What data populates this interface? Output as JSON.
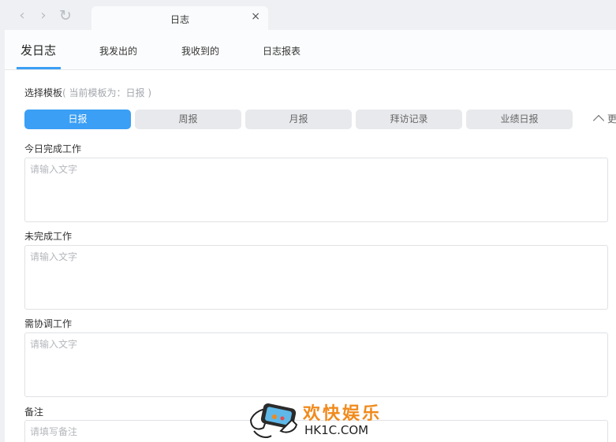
{
  "browser": {
    "back_icon": "‹",
    "forward_icon": "›",
    "reload_icon": "↻",
    "tab_title": "日志",
    "close_icon": "×"
  },
  "subnav": {
    "items": [
      "发日志",
      "我发出的",
      "我收到的",
      "日志报表"
    ],
    "active_index": 0,
    "accent": "#3a9ff5"
  },
  "template": {
    "label": "选择模板",
    "note": "( 当前模板为：日报 )",
    "buttons": [
      "日报",
      "周报",
      "月报",
      "拜访记录",
      "业绩日报"
    ],
    "active_index": 0,
    "more_label": "更"
  },
  "fields": [
    {
      "label": "今日完成工作",
      "value": "",
      "placeholder": "请输入文字"
    },
    {
      "label": "未完成工作",
      "value": "",
      "placeholder": "请输入文字"
    },
    {
      "label": "需协调工作",
      "value": "",
      "placeholder": "请输入文字"
    },
    {
      "label": "备注",
      "value": "",
      "placeholder": "请填写备注"
    }
  ],
  "watermark": {
    "cn": "欢快娱乐",
    "en": "HK1C.COM"
  }
}
